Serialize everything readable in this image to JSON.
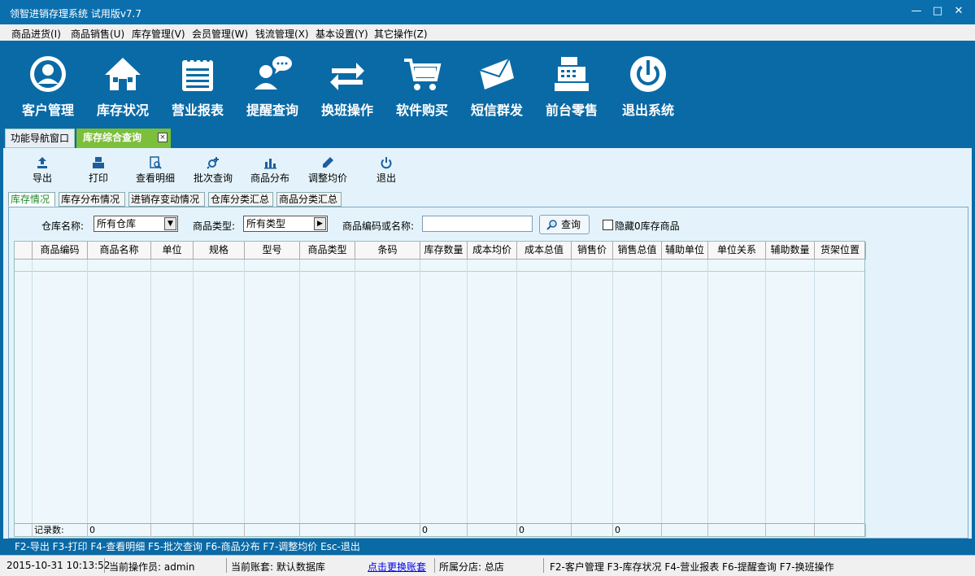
{
  "window": {
    "title": "领智进销存理系统 试用版v7.7",
    "min": "—",
    "max": "□",
    "close": "✕"
  },
  "menu": [
    "商品进货(I)",
    "商品销售(U)",
    "库存管理(V)",
    "会员管理(W)",
    "钱流管理(X)",
    "基本设置(Y)",
    "其它操作(Z)"
  ],
  "banner": [
    "客户管理",
    "库存状况",
    "营业报表",
    "提醒查询",
    "换班操作",
    "软件购买",
    "短信群发",
    "前台零售",
    "退出系统"
  ],
  "tabs": {
    "nav": "功能导航窗口",
    "active": "库存综合查询",
    "close": "×"
  },
  "toolbar": [
    "导出",
    "打印",
    "查看明细",
    "批次查询",
    "商品分布",
    "调整均价",
    "退出"
  ],
  "subtabs": [
    "库存情况",
    "库存分布情况",
    "进销存变动情况",
    "仓库分类汇总",
    "商品分类汇总"
  ],
  "filter": {
    "warehouse_label": "仓库名称:",
    "warehouse_value": "所有仓库",
    "type_label": "商品类型:",
    "type_value": "所有类型",
    "code_label": "商品编码或名称:",
    "code_value": "",
    "query_button": "查询",
    "hide_zero_label": "隐藏0库存商品"
  },
  "grid": {
    "columns": [
      "商品编码",
      "商品名称",
      "单位",
      "规格",
      "型号",
      "商品类型",
      "条码",
      "库存数量",
      "成本均价",
      "成本总值",
      "销售价",
      "销售总值",
      "辅助单位",
      "单位关系",
      "辅助数量",
      "货架位置"
    ],
    "footer": {
      "label": "记录数:",
      "count": "0",
      "qty_total": "0",
      "cost_total": "0",
      "sales_total": "0"
    }
  },
  "hint_bar": "F2-导出 F3-打印 F4-查看明细 F5-批次查询 F6-商品分布 F7-调整均价 Esc-退出",
  "status": {
    "datetime": "2015-10-31 10:13:52",
    "operator": "当前操作员: admin",
    "account": "当前账套: 默认数据库",
    "switch_link": "点击更换账套",
    "store": "所属分店: 总店",
    "shortcuts": "F2-客户管理 F3-库存状况 F4-营业报表 F6-提醒查询 F7-换班操作"
  },
  "colors": {
    "banner_bg": "#0a6aa6",
    "active_tab": "#7cbf3a",
    "content_bg": "#e4f3fb"
  }
}
